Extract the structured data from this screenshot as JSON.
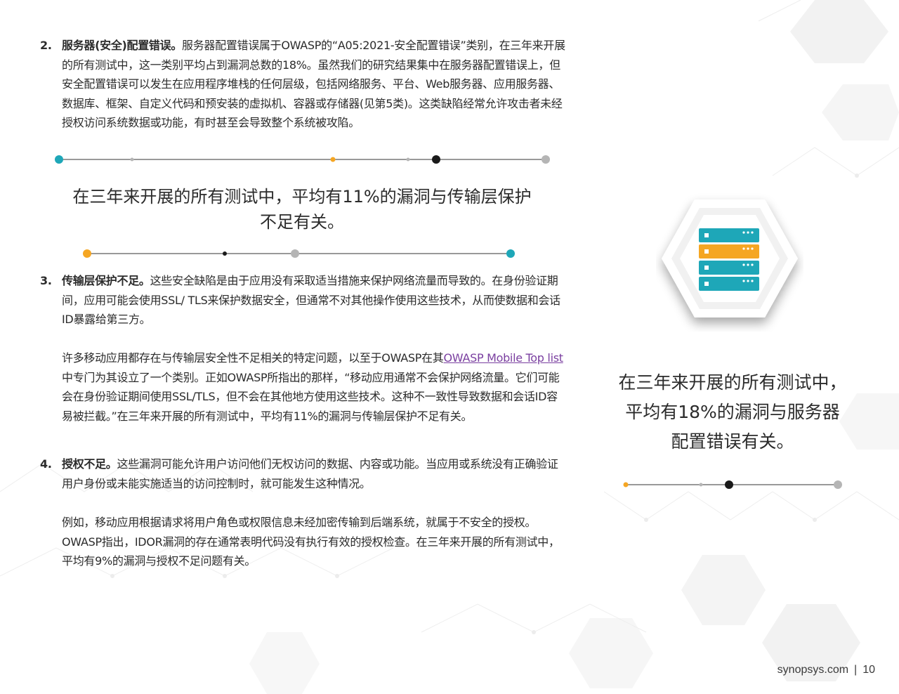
{
  "items": [
    {
      "number": "2.",
      "lead": "服务器(安全)配置错误。",
      "text": "服务器配置错误属于OWASP的“A05:2021-安全配置错误”类别，在三年来开展的所有测试中，这一类别平均占到漏洞总数的18%。虽然我们的研究结果集中在服务器配置错误上，但安全配置错误可以发生在应用程序堆栈的任何层级，包括网络服务、平台、Web服务器、应用服务器、数据库、框架、自定义代码和预安装的虚拟机、容器或存储器(见第5类)。这类缺陷经常允许攻击者未经授权访问系统数据或功能，有时甚至会导致整个系统被攻陷。"
    },
    {
      "number": "3.",
      "lead": "传输层保护不足。",
      "text": "这些安全缺陷是由于应用没有采取适当措施来保护网络流量而导致的。在身份验证期间，应用可能会使用SSL/ TLS来保护数据安全，但通常不对其他操作使用这些技术，从而使数据和会话ID暴露给第三方。"
    },
    {
      "number": "4.",
      "lead": "授权不足。",
      "text": "这些漏洞可能允许用户访问他们无权访问的数据、内容或功能。当应用或系统没有正确验证用户身份或未能实施适当的访问控制时，就可能发生这种情况。"
    }
  ],
  "paragraph_mobile": {
    "before": "许多移动应用都存在与传输层安全性不足相关的特定问题，以至于OWASP在其",
    "link": "OWASP Mobile Top list",
    "after": "中专门为其设立了一个类别。正如OWASP所指出的那样，“移动应用通常不会保护网络流量。它们可能会在身份验证期间使用SSL/TLS，但不会在其他地方使用这些技术。这种不一致性导致数据和会话ID容易被拦截。”在三年来开展的所有测试中，平均有11%的漏洞与传输层保护不足有关。"
  },
  "paragraph_idor": "例如，移动应用根据请求将用户角色或权限信息未经加密传输到后端系统，就属于不安全的授权。OWASP指出，IDOR漏洞的存在通常表明代码没有执行有效的授权检查。在三年来开展的所有测试中，平均有9%的漏洞与授权不足问题有关。",
  "pull_quote_center": "在三年来开展的所有测试中，平均有11%的漏洞与传输层保护不足有关。",
  "pull_quote_right": "在三年来开展的所有测试中，平均有18%的漏洞与服务器配置错误有关。",
  "footer": {
    "site": "synopsys.com",
    "separator": "|",
    "page": "10"
  },
  "colors": {
    "teal": "#1ea7b8",
    "orange": "#f5a623",
    "dark": "#1a1a1a",
    "gray": "#b5b5b5",
    "link": "#7a3fa0"
  },
  "icon": "server-rack-icon"
}
